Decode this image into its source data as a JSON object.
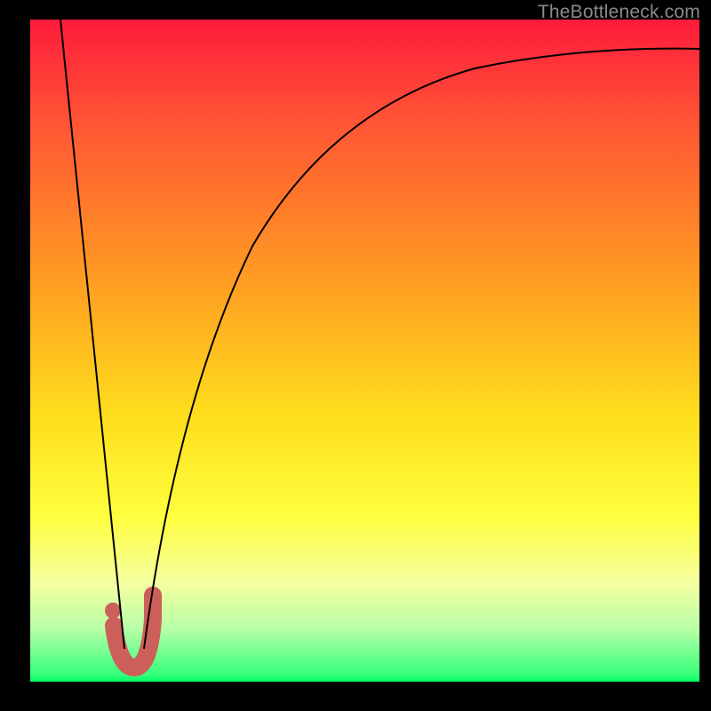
{
  "watermark": "TheBottleneck.com",
  "gradient_colors": {
    "top": "#fe1b3c",
    "mid1": "#ff8029",
    "mid2": "#fede1d",
    "mid3": "#feff3e",
    "bottom": "#00ff61"
  },
  "chart_data": {
    "type": "line",
    "title": "",
    "xlabel": "",
    "ylabel": "",
    "xlim": [
      0,
      100
    ],
    "ylim": [
      0,
      100
    ],
    "series": [
      {
        "name": "left-descent",
        "x": [
          4.5,
          14
        ],
        "y": [
          100,
          5
        ],
        "stroke": "#000000",
        "width": 2
      },
      {
        "name": "right-ascent",
        "x": [
          17,
          20,
          25,
          30,
          35,
          40,
          50,
          60,
          70,
          80,
          90,
          100
        ],
        "y": [
          5,
          25,
          48,
          62,
          71,
          77,
          84,
          88.5,
          91.5,
          93.5,
          94.8,
          95.5
        ],
        "stroke": "#000000",
        "width": 2
      },
      {
        "name": "j-hook",
        "x": [
          12.5,
          13.3,
          14.3,
          15.5,
          16.8,
          17.8,
          18.3,
          18.3
        ],
        "y": [
          8.5,
          4.0,
          2.2,
          1.8,
          2.5,
          5.0,
          9.5,
          13.0
        ],
        "stroke": "#cd5f5a",
        "width": 20
      },
      {
        "name": "j-dot",
        "x": [
          12.3
        ],
        "y": [
          10.8
        ],
        "stroke": "#cd5f5a",
        "radius": 9
      }
    ]
  }
}
